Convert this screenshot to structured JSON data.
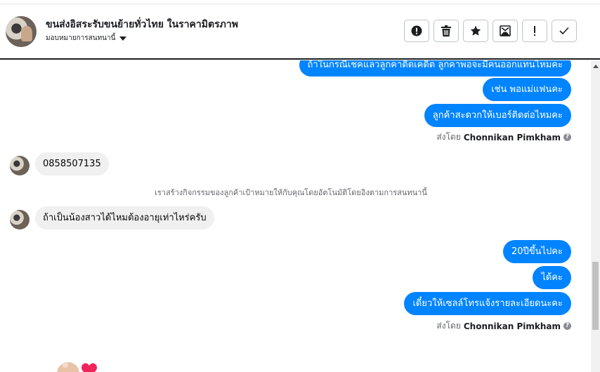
{
  "header": {
    "title": "ขนส่งอิสระรับขนย้ายทั่วไทย ในราคามิตรภาพ",
    "assign_label": "มอบหมายการสนทนานี้",
    "actions": [
      {
        "icon": "alert-circle-icon"
      },
      {
        "icon": "trash-icon"
      },
      {
        "icon": "star-icon"
      },
      {
        "icon": "mark-unread-icon"
      },
      {
        "icon": "exclamation-icon"
      },
      {
        "icon": "check-icon"
      }
    ]
  },
  "chat": {
    "out_top_partial": "ถ้าในกรณีเชคแลวลูกคาติดเคดิต ลูกคาพอจะมีคนออกแทนไหมคะ",
    "out_1": "เช่น พอแม่แฟนคะ",
    "out_2": "ลูกค้าสะดวกให้เบอร์ติดต่อไหมคะ",
    "sent_by_1": {
      "prefix": "ส่งโดย",
      "name": "Chonnikan Pimkham"
    },
    "in_1": "0858507135",
    "system_note": "เราสร้างกิจกรรมของลูกค้าเป้าหมายให้กับคุณโดยอัตโนมัติโดยอิงตามการสนทนานี้",
    "in_2": "ถ้าเป็นน้องสาวได้ไหมต้องอายุเท่าไหร่ครับ",
    "out_3": "20ปีขึ้นไปคะ",
    "out_4": "ได้คะ",
    "out_5": "เดี๋ยวให้เซลล์โทรแจ้งรายละเอียดนะคะ",
    "sent_by_2": {
      "prefix": "ส่งโดย",
      "name": "Chonnikan Pimkham"
    }
  },
  "colors": {
    "outgoing_bubble": "#0084ff",
    "incoming_bubble": "#f0f0f0",
    "header_border": "#1c1e21"
  }
}
